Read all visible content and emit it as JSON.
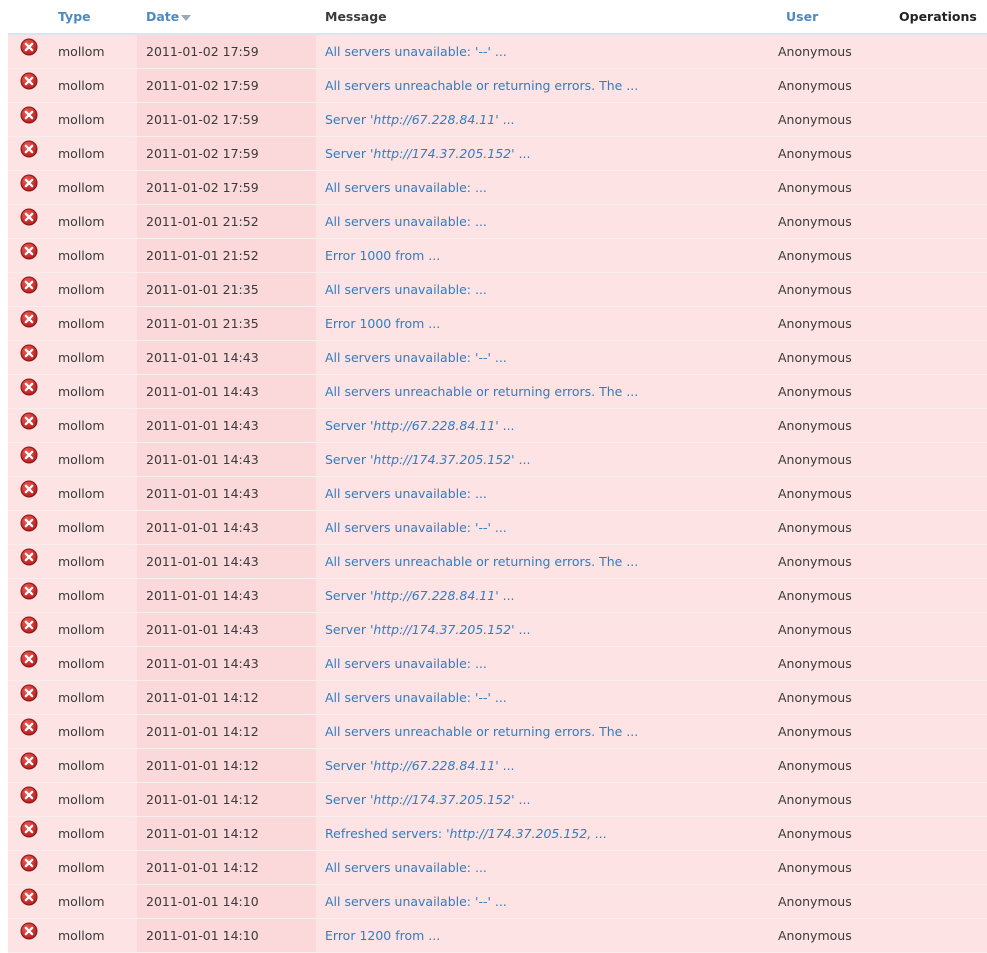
{
  "header": {
    "type": "Type",
    "date": "Date",
    "message": "Message",
    "user": "User",
    "operations": "Operations"
  },
  "colors": {
    "link": "#2f7ec2",
    "error_row": "#fde3e3",
    "error_icon": "#cc2b2b"
  },
  "rows": [
    {
      "icon": "error-icon",
      "type": "mollom",
      "date": "2011-01-02 17:59",
      "msg_prefix": "All servers unavailable: ",
      "msg_italic": "'--'",
      "msg_suffix": " ...",
      "user": "Anonymous",
      "ops": ""
    },
    {
      "icon": "error-icon",
      "type": "mollom",
      "date": "2011-01-02 17:59",
      "msg_prefix": "All servers unreachable or returning errors. The ...",
      "msg_italic": "",
      "msg_suffix": "",
      "user": "Anonymous",
      "ops": ""
    },
    {
      "icon": "error-icon",
      "type": "mollom",
      "date": "2011-01-02 17:59",
      "msg_prefix": "Server ",
      "msg_italic": "'http://67.228.84.11'",
      "msg_suffix": " ...",
      "user": "Anonymous",
      "ops": ""
    },
    {
      "icon": "error-icon",
      "type": "mollom",
      "date": "2011-01-02 17:59",
      "msg_prefix": "Server ",
      "msg_italic": "'http://174.37.205.152'",
      "msg_suffix": " ...",
      "user": "Anonymous",
      "ops": ""
    },
    {
      "icon": "error-icon",
      "type": "mollom",
      "date": "2011-01-02 17:59",
      "msg_prefix": "All servers unavailable: ...",
      "msg_italic": "",
      "msg_suffix": "",
      "user": "Anonymous",
      "ops": ""
    },
    {
      "icon": "error-icon",
      "type": "mollom",
      "date": "2011-01-01 21:52",
      "msg_prefix": "All servers unavailable: ...",
      "msg_italic": "",
      "msg_suffix": "",
      "user": "Anonymous",
      "ops": ""
    },
    {
      "icon": "error-icon",
      "type": "mollom",
      "date": "2011-01-01 21:52",
      "msg_prefix": "Error 1000 from ...",
      "msg_italic": "",
      "msg_suffix": "",
      "user": "Anonymous",
      "ops": ""
    },
    {
      "icon": "error-icon",
      "type": "mollom",
      "date": "2011-01-01 21:35",
      "msg_prefix": "All servers unavailable: ...",
      "msg_italic": "",
      "msg_suffix": "",
      "user": "Anonymous",
      "ops": ""
    },
    {
      "icon": "error-icon",
      "type": "mollom",
      "date": "2011-01-01 21:35",
      "msg_prefix": "Error 1000 from ...",
      "msg_italic": "",
      "msg_suffix": "",
      "user": "Anonymous",
      "ops": ""
    },
    {
      "icon": "error-icon",
      "type": "mollom",
      "date": "2011-01-01 14:43",
      "msg_prefix": "All servers unavailable: ",
      "msg_italic": "'--'",
      "msg_suffix": " ...",
      "user": "Anonymous",
      "ops": ""
    },
    {
      "icon": "error-icon",
      "type": "mollom",
      "date": "2011-01-01 14:43",
      "msg_prefix": "All servers unreachable or returning errors. The ...",
      "msg_italic": "",
      "msg_suffix": "",
      "user": "Anonymous",
      "ops": ""
    },
    {
      "icon": "error-icon",
      "type": "mollom",
      "date": "2011-01-01 14:43",
      "msg_prefix": "Server ",
      "msg_italic": "'http://67.228.84.11'",
      "msg_suffix": " ...",
      "user": "Anonymous",
      "ops": ""
    },
    {
      "icon": "error-icon",
      "type": "mollom",
      "date": "2011-01-01 14:43",
      "msg_prefix": "Server ",
      "msg_italic": "'http://174.37.205.152'",
      "msg_suffix": " ...",
      "user": "Anonymous",
      "ops": ""
    },
    {
      "icon": "error-icon",
      "type": "mollom",
      "date": "2011-01-01 14:43",
      "msg_prefix": "All servers unavailable: ...",
      "msg_italic": "",
      "msg_suffix": "",
      "user": "Anonymous",
      "ops": ""
    },
    {
      "icon": "error-icon",
      "type": "mollom",
      "date": "2011-01-01 14:43",
      "msg_prefix": "All servers unavailable: ",
      "msg_italic": "'--'",
      "msg_suffix": " ...",
      "user": "Anonymous",
      "ops": ""
    },
    {
      "icon": "error-icon",
      "type": "mollom",
      "date": "2011-01-01 14:43",
      "msg_prefix": "All servers unreachable or returning errors. The ...",
      "msg_italic": "",
      "msg_suffix": "",
      "user": "Anonymous",
      "ops": ""
    },
    {
      "icon": "error-icon",
      "type": "mollom",
      "date": "2011-01-01 14:43",
      "msg_prefix": "Server ",
      "msg_italic": "'http://67.228.84.11'",
      "msg_suffix": " ...",
      "user": "Anonymous",
      "ops": ""
    },
    {
      "icon": "error-icon",
      "type": "mollom",
      "date": "2011-01-01 14:43",
      "msg_prefix": "Server ",
      "msg_italic": "'http://174.37.205.152'",
      "msg_suffix": " ...",
      "user": "Anonymous",
      "ops": ""
    },
    {
      "icon": "error-icon",
      "type": "mollom",
      "date": "2011-01-01 14:43",
      "msg_prefix": "All servers unavailable: ...",
      "msg_italic": "",
      "msg_suffix": "",
      "user": "Anonymous",
      "ops": ""
    },
    {
      "icon": "error-icon",
      "type": "mollom",
      "date": "2011-01-01 14:12",
      "msg_prefix": "All servers unavailable: ",
      "msg_italic": "'--'",
      "msg_suffix": " ...",
      "user": "Anonymous",
      "ops": ""
    },
    {
      "icon": "error-icon",
      "type": "mollom",
      "date": "2011-01-01 14:12",
      "msg_prefix": "All servers unreachable or returning errors. The ...",
      "msg_italic": "",
      "msg_suffix": "",
      "user": "Anonymous",
      "ops": ""
    },
    {
      "icon": "error-icon",
      "type": "mollom",
      "date": "2011-01-01 14:12",
      "msg_prefix": "Server ",
      "msg_italic": "'http://67.228.84.11'",
      "msg_suffix": " ...",
      "user": "Anonymous",
      "ops": ""
    },
    {
      "icon": "error-icon",
      "type": "mollom",
      "date": "2011-01-01 14:12",
      "msg_prefix": "Server ",
      "msg_italic": "'http://174.37.205.152'",
      "msg_suffix": " ...",
      "user": "Anonymous",
      "ops": ""
    },
    {
      "icon": "error-icon",
      "type": "mollom",
      "date": "2011-01-01 14:12",
      "msg_prefix": "Refreshed servers: ",
      "msg_italic": "'http://174.37.205.152, ...",
      "msg_suffix": "",
      "user": "Anonymous",
      "ops": ""
    },
    {
      "icon": "error-icon",
      "type": "mollom",
      "date": "2011-01-01 14:12",
      "msg_prefix": "All servers unavailable: ...",
      "msg_italic": "",
      "msg_suffix": "",
      "user": "Anonymous",
      "ops": ""
    },
    {
      "icon": "error-icon",
      "type": "mollom",
      "date": "2011-01-01 14:10",
      "msg_prefix": "All servers unavailable: ",
      "msg_italic": "'--'",
      "msg_suffix": " ...",
      "user": "Anonymous",
      "ops": ""
    },
    {
      "icon": "error-icon",
      "type": "mollom",
      "date": "2011-01-01 14:10",
      "msg_prefix": "Error 1200 from ...",
      "msg_italic": "",
      "msg_suffix": "",
      "user": "Anonymous",
      "ops": ""
    }
  ]
}
